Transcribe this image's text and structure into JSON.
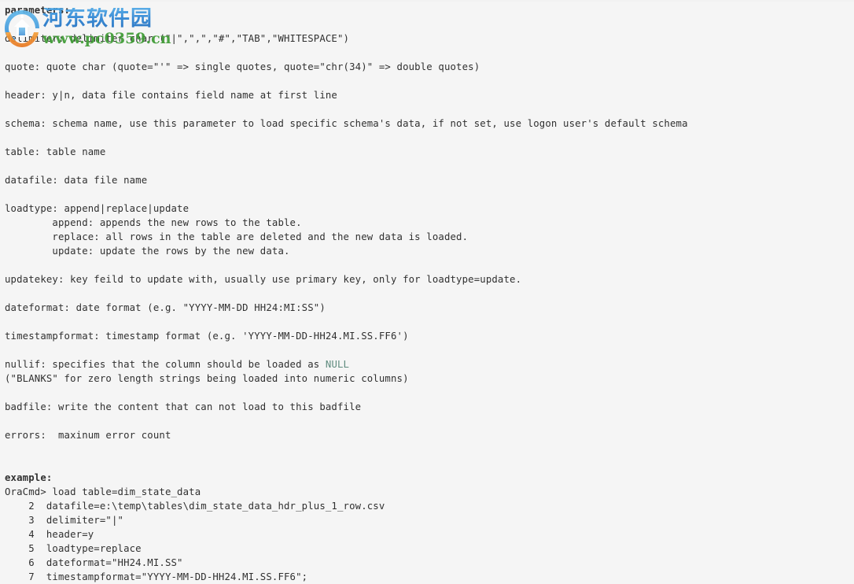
{
  "document": {
    "title_line": "parameters:",
    "lines": [
      {
        "text": "parameters:",
        "bold": true
      },
      {
        "text": ""
      },
      {
        "text": "delimiter: delimiter char (\"|\",\",\",\"#\",\"TAB\",\"WHITESPACE\")"
      },
      {
        "text": ""
      },
      {
        "text": "quote: quote char (quote=\"'\" => single quotes, quote=\"chr(34)\" => double quotes)"
      },
      {
        "text": ""
      },
      {
        "text": "header: y|n, data file contains field name at first line"
      },
      {
        "text": ""
      },
      {
        "text": "schema: schema name, use this parameter to load specific schema's data, if not set, use logon user's default schema"
      },
      {
        "text": ""
      },
      {
        "text": "table: table name"
      },
      {
        "text": ""
      },
      {
        "text": "datafile: data file name"
      },
      {
        "text": ""
      },
      {
        "text": "loadtype: append|replace|update"
      },
      {
        "text": "        append: appends the new rows to the table."
      },
      {
        "text": "        replace: all rows in the table are deleted and the new data is loaded."
      },
      {
        "text": "        update: update the rows by the new data."
      },
      {
        "text": ""
      },
      {
        "text": "updatekey: key feild to update with, usually use primary key, only for loadtype=update."
      },
      {
        "text": ""
      },
      {
        "text": "dateformat: date format (e.g. \"YYYY-MM-DD HH24:MI:SS\")"
      },
      {
        "text": ""
      },
      {
        "text": "timestampformat: timestamp format (e.g. 'YYYY-MM-DD-HH24.MI.SS.FF6')"
      },
      {
        "text": ""
      },
      {
        "text": "nullif: specifies that the column should be loaded as ",
        "suffix_keyword": "NULL"
      },
      {
        "text": "(\"BLANKS\" for zero length strings being loaded into numeric columns)"
      },
      {
        "text": ""
      },
      {
        "text": "badfile: write the content that can not load to this badfile"
      },
      {
        "text": ""
      },
      {
        "text": "errors:  maxinum error count"
      },
      {
        "text": ""
      },
      {
        "text": ""
      },
      {
        "text": "example:",
        "bold": true
      },
      {
        "text": "OraCmd> load table=dim_state_data"
      },
      {
        "text": "    2  datafile=e:\\temp\\tables\\dim_state_data_hdr_plus_1_row.csv"
      },
      {
        "text": "    3  delimiter=\"|\""
      },
      {
        "text": "    4  header=y"
      },
      {
        "text": "    5  loadtype=replace"
      },
      {
        "text": "    6  dateformat=\"HH24.MI.SS\""
      },
      {
        "text": "    7  timestampformat=\"YYYY-MM-DD-HH24.MI.SS.FF6\";"
      }
    ],
    "keyword_null": "NULL"
  },
  "watermark": {
    "site_name_cn": "河东软件园",
    "site_url": "www.pc0359.cn",
    "logo_icon": "pc0359-circle-logo",
    "cn_color": "#2f86d4",
    "url_color": "#3f9b35",
    "logo_blue": "#3f9fd8",
    "logo_orange": "#ef8a2b"
  },
  "theme": {
    "background": "#f5f5f5",
    "text_color": "#303030",
    "keyword_color": "#5e8b7e"
  }
}
